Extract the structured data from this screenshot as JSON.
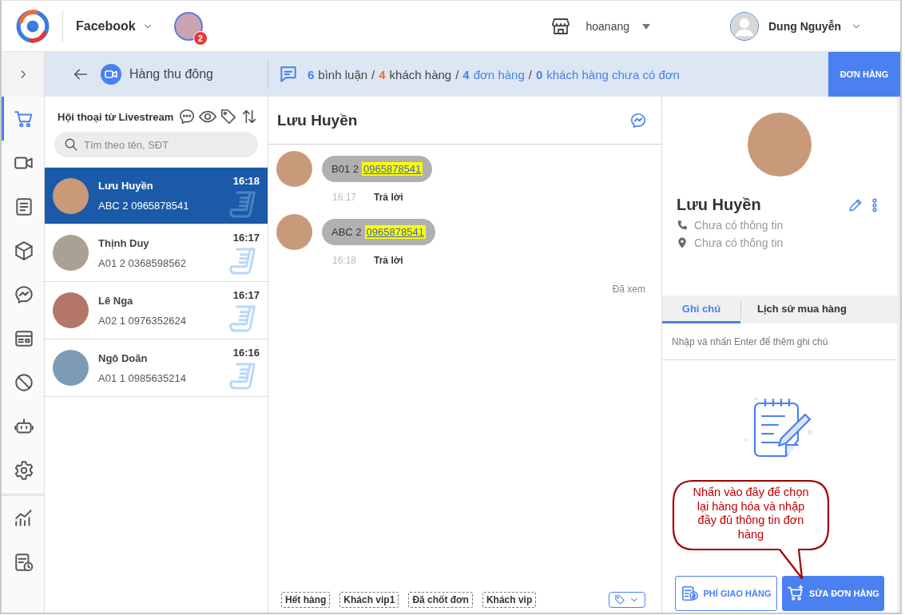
{
  "header": {
    "account": {
      "label": "Facebook"
    },
    "page_badge": "2",
    "store": {
      "name": "hoanang"
    },
    "user": {
      "name": "Dung Nguyễn"
    }
  },
  "toolbar": {
    "livestream_title": "Hàng thu đông",
    "stats": [
      {
        "count": "6",
        "label": "bình luận",
        "color": "#4a7fe6",
        "kind": "plain"
      },
      {
        "separator": "/",
        "count": "4",
        "label": "khách hàng",
        "color": "#f06a28",
        "kind": "plain"
      },
      {
        "separator": "/",
        "count": "4",
        "label": "đơn hàng",
        "color": "#4a7fe6",
        "kind": "link"
      },
      {
        "separator": "/",
        "count": "0",
        "label": "khách hàng chưa có đơn",
        "color": "#4a7fe6",
        "kind": "link"
      }
    ],
    "order_button": "ĐƠN HÀNG"
  },
  "rail": {
    "items": [
      {
        "kind": "cart",
        "selected": true
      },
      {
        "kind": "video",
        "selected": false
      },
      {
        "kind": "document",
        "selected": false
      },
      {
        "kind": "box",
        "selected": false
      },
      {
        "kind": "messenger",
        "selected": false
      },
      {
        "kind": "card",
        "selected": false
      },
      {
        "kind": "ban",
        "selected": false
      },
      {
        "kind": "robot",
        "selected": false
      },
      {
        "kind": "gear",
        "selected": false
      }
    ],
    "bottom_items": [
      {
        "kind": "chart",
        "selected": false
      },
      {
        "kind": "report",
        "selected": false
      }
    ]
  },
  "conversations": {
    "title": "Hội thoại từ Livestream",
    "search": {
      "placeholder": "Tìm theo tên, SĐT"
    },
    "items": [
      {
        "name": "Lưu Huyền",
        "preview": "ABC 2 0965878541",
        "time": "16:18",
        "selected": true
      },
      {
        "name": "Thịnh Duy",
        "preview": "A01 2 0368598562",
        "time": "16:17",
        "selected": false
      },
      {
        "name": "Lê Nga",
        "preview": "A02 1 0976352624",
        "time": "16:17",
        "selected": false
      },
      {
        "name": "Ngô Doãn",
        "preview": "A01 1 0985635214",
        "time": "16:16",
        "selected": false
      }
    ]
  },
  "chat": {
    "title": "Lưu Huyền",
    "messages": [
      {
        "text": "B01 2",
        "phone": "0965878541",
        "time": "16:17",
        "reply": "Trả lời"
      },
      {
        "text": "ABC 2",
        "phone": "0965878541",
        "time": "16:18",
        "reply": "Trả lời"
      }
    ],
    "seen": "Đã xem",
    "tags": [
      "Hết hàng",
      "Khách vip1",
      "Đã chốt đơn",
      "Khách vip"
    ]
  },
  "customer": {
    "name": "Lưu Huyền",
    "phone": "Chưa có thông tin",
    "address": "Chưa có thông tin",
    "tabs": [
      {
        "label": "Ghi chú",
        "selected": true
      },
      {
        "label": "Lịch sử mua hàng",
        "selected": false
      }
    ],
    "note": {
      "placeholder": "Nhập và nhấn Enter để thêm ghi chú"
    },
    "buttons": [
      {
        "kind": "shipping",
        "label": "PHÍ GIAO HÀNG"
      },
      {
        "kind": "edit_order",
        "label": "SỬA ĐƠN HÀNG"
      }
    ]
  },
  "callout": {
    "text": "Nhấn vào đây để chọn lại hàng hóa và nhập đầy đủ thông tin đơn hàng"
  }
}
